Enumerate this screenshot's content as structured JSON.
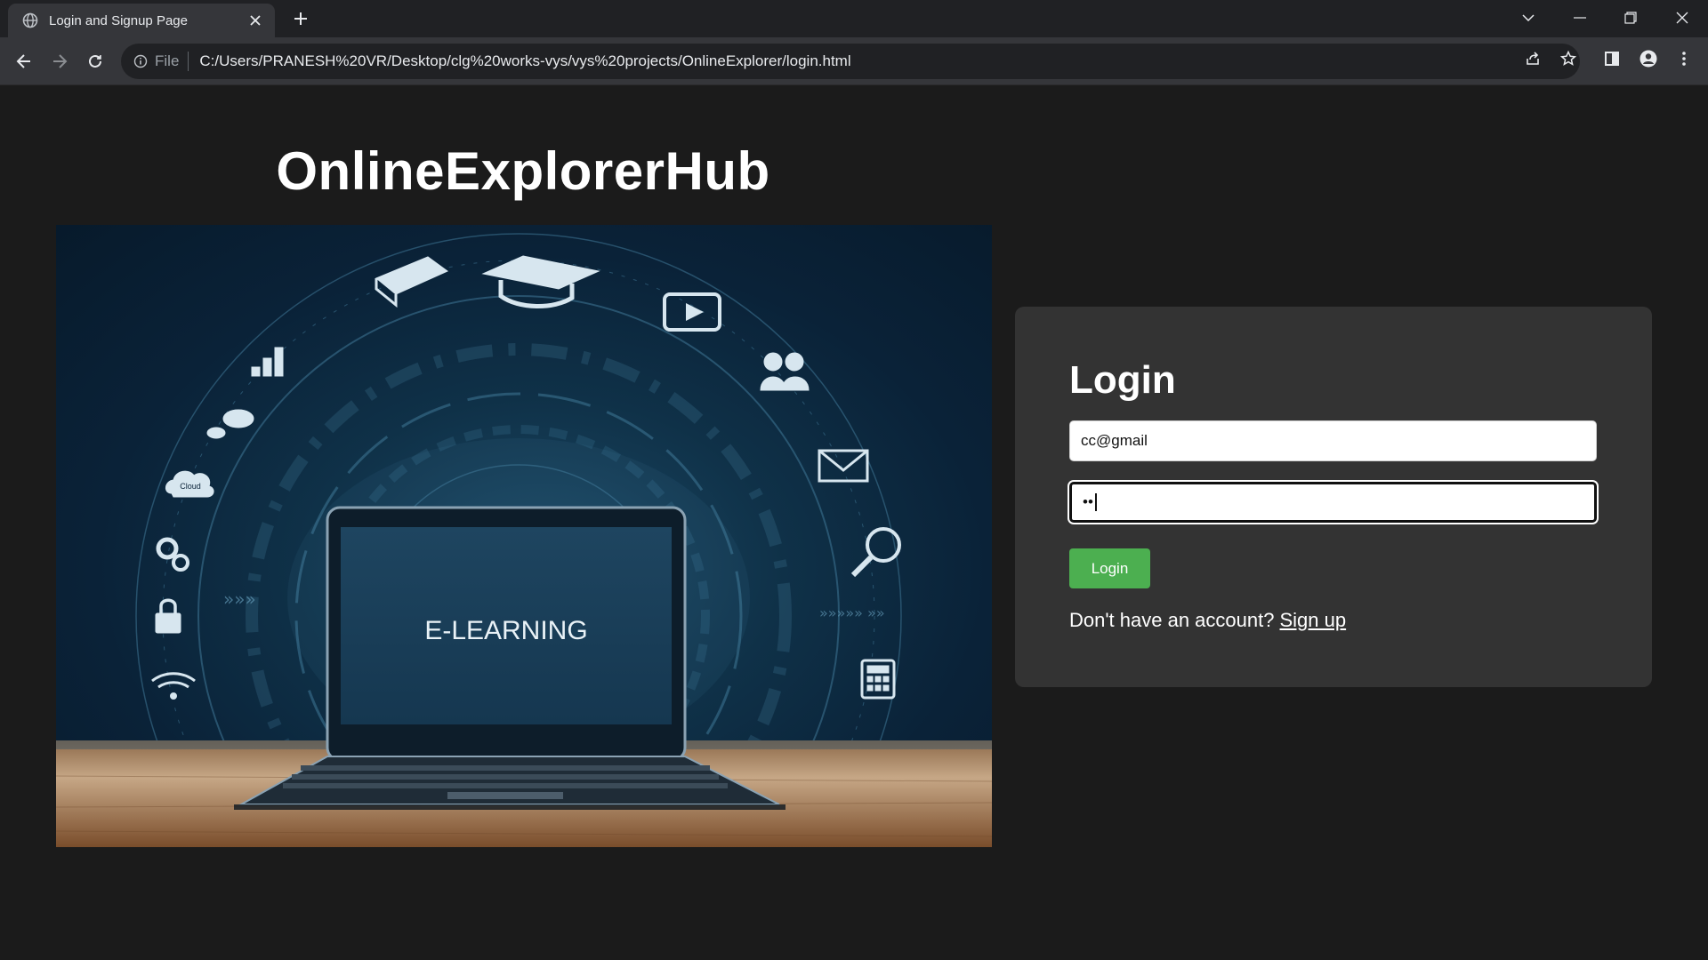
{
  "browser": {
    "tab_title": "Login and Signup Page",
    "address_chip": "File",
    "url": "C:/Users/PRANESH%20VR/Desktop/clg%20works-vys/vys%20projects/OnlineExplorer/login.html"
  },
  "page": {
    "site_title": "OnlineExplorerHub",
    "hero_screen_text": "E-LEARNING",
    "hero_cloud_text": "Cloud"
  },
  "login": {
    "heading": "Login",
    "email_value": "cc@gmail",
    "password_mask": "••",
    "button_label": "Login",
    "signup_prompt": "Don't have an account?",
    "signup_link": "Sign up"
  },
  "colors": {
    "accent_green": "#4caf50",
    "card_bg": "#333333",
    "page_bg": "#1b1b1b"
  }
}
